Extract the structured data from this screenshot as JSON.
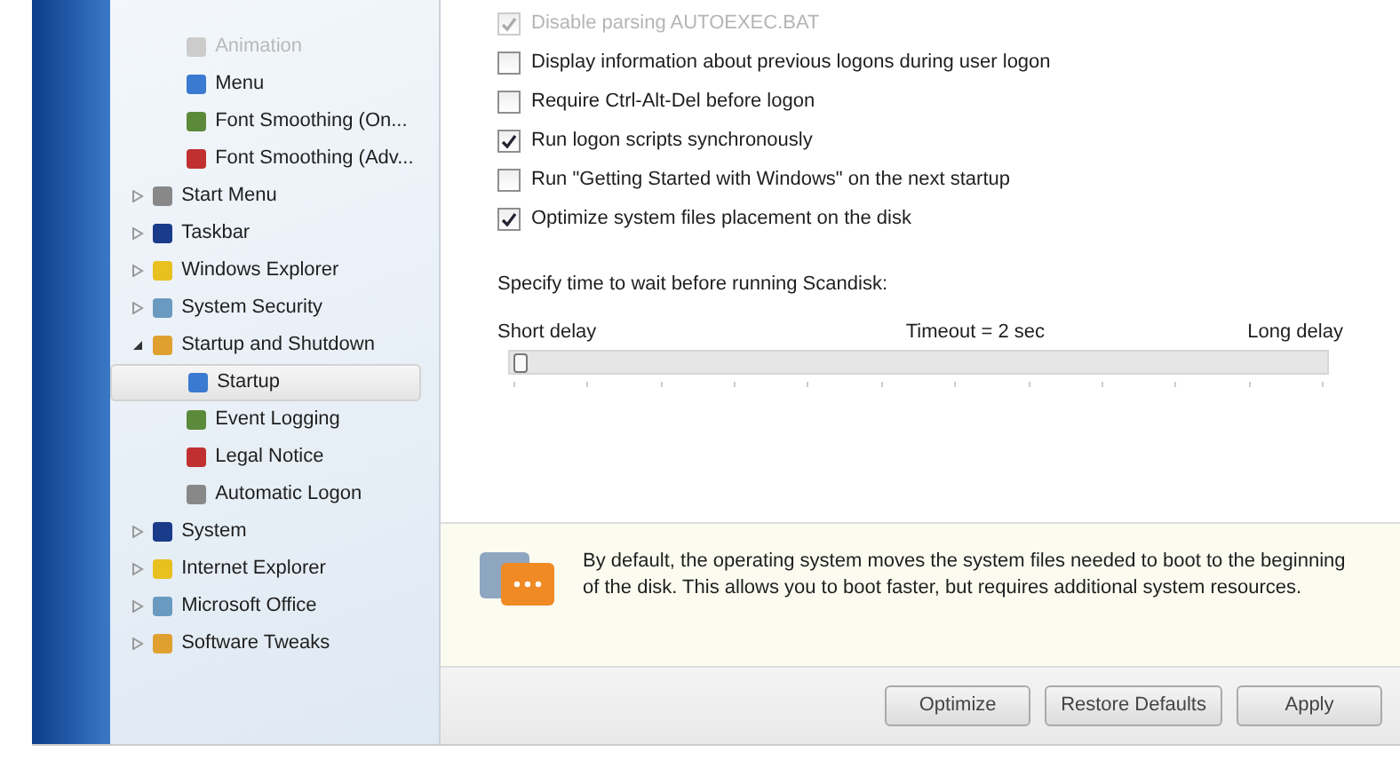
{
  "tree_top_children": [
    {
      "label": "Animation",
      "disabled": true
    },
    {
      "label": "Menu",
      "disabled": false
    },
    {
      "label": "Font Smoothing (On...",
      "disabled": false
    },
    {
      "label": "Font Smoothing (Adv...",
      "disabled": false
    }
  ],
  "tree": [
    {
      "label": "Start Menu",
      "expanded": false
    },
    {
      "label": "Taskbar",
      "expanded": false
    },
    {
      "label": "Windows Explorer",
      "expanded": false
    },
    {
      "label": "System Security",
      "expanded": false
    },
    {
      "label": "Startup and Shutdown",
      "expanded": true,
      "children": [
        {
          "label": "Startup",
          "selected": true
        },
        {
          "label": "Event Logging",
          "selected": false
        },
        {
          "label": "Legal Notice",
          "selected": false
        },
        {
          "label": "Automatic Logon",
          "selected": false
        }
      ]
    },
    {
      "label": "System",
      "expanded": false
    },
    {
      "label": "Internet Explorer",
      "expanded": false
    },
    {
      "label": "Microsoft Office",
      "expanded": false
    },
    {
      "label": "Software Tweaks",
      "expanded": false
    }
  ],
  "options": [
    {
      "label": "Disable parsing AUTOEXEC.BAT",
      "checked": true,
      "disabled": true
    },
    {
      "label": "Display information about previous logons during user logon",
      "checked": false,
      "disabled": false
    },
    {
      "label": "Require Ctrl-Alt-Del before logon",
      "checked": false,
      "disabled": false
    },
    {
      "label": "Run logon scripts synchronously",
      "checked": true,
      "disabled": false
    },
    {
      "label": "Run \"Getting Started with Windows\" on the next startup",
      "checked": false,
      "disabled": false
    },
    {
      "label": "Optimize system files placement on the disk",
      "checked": true,
      "disabled": false
    }
  ],
  "scandisk": {
    "label": "Specify time to wait before running Scandisk:",
    "min_label": "Short delay",
    "value_label": "Timeout = 2 sec",
    "max_label": "Long delay",
    "level": 0
  },
  "info": {
    "text": "By default, the operating system moves the system files needed to boot to the beginning of the disk. This allows you to boot faster, but requires additional system resources."
  },
  "buttons": [
    "Optimize",
    "Restore Defaults",
    "Apply"
  ]
}
